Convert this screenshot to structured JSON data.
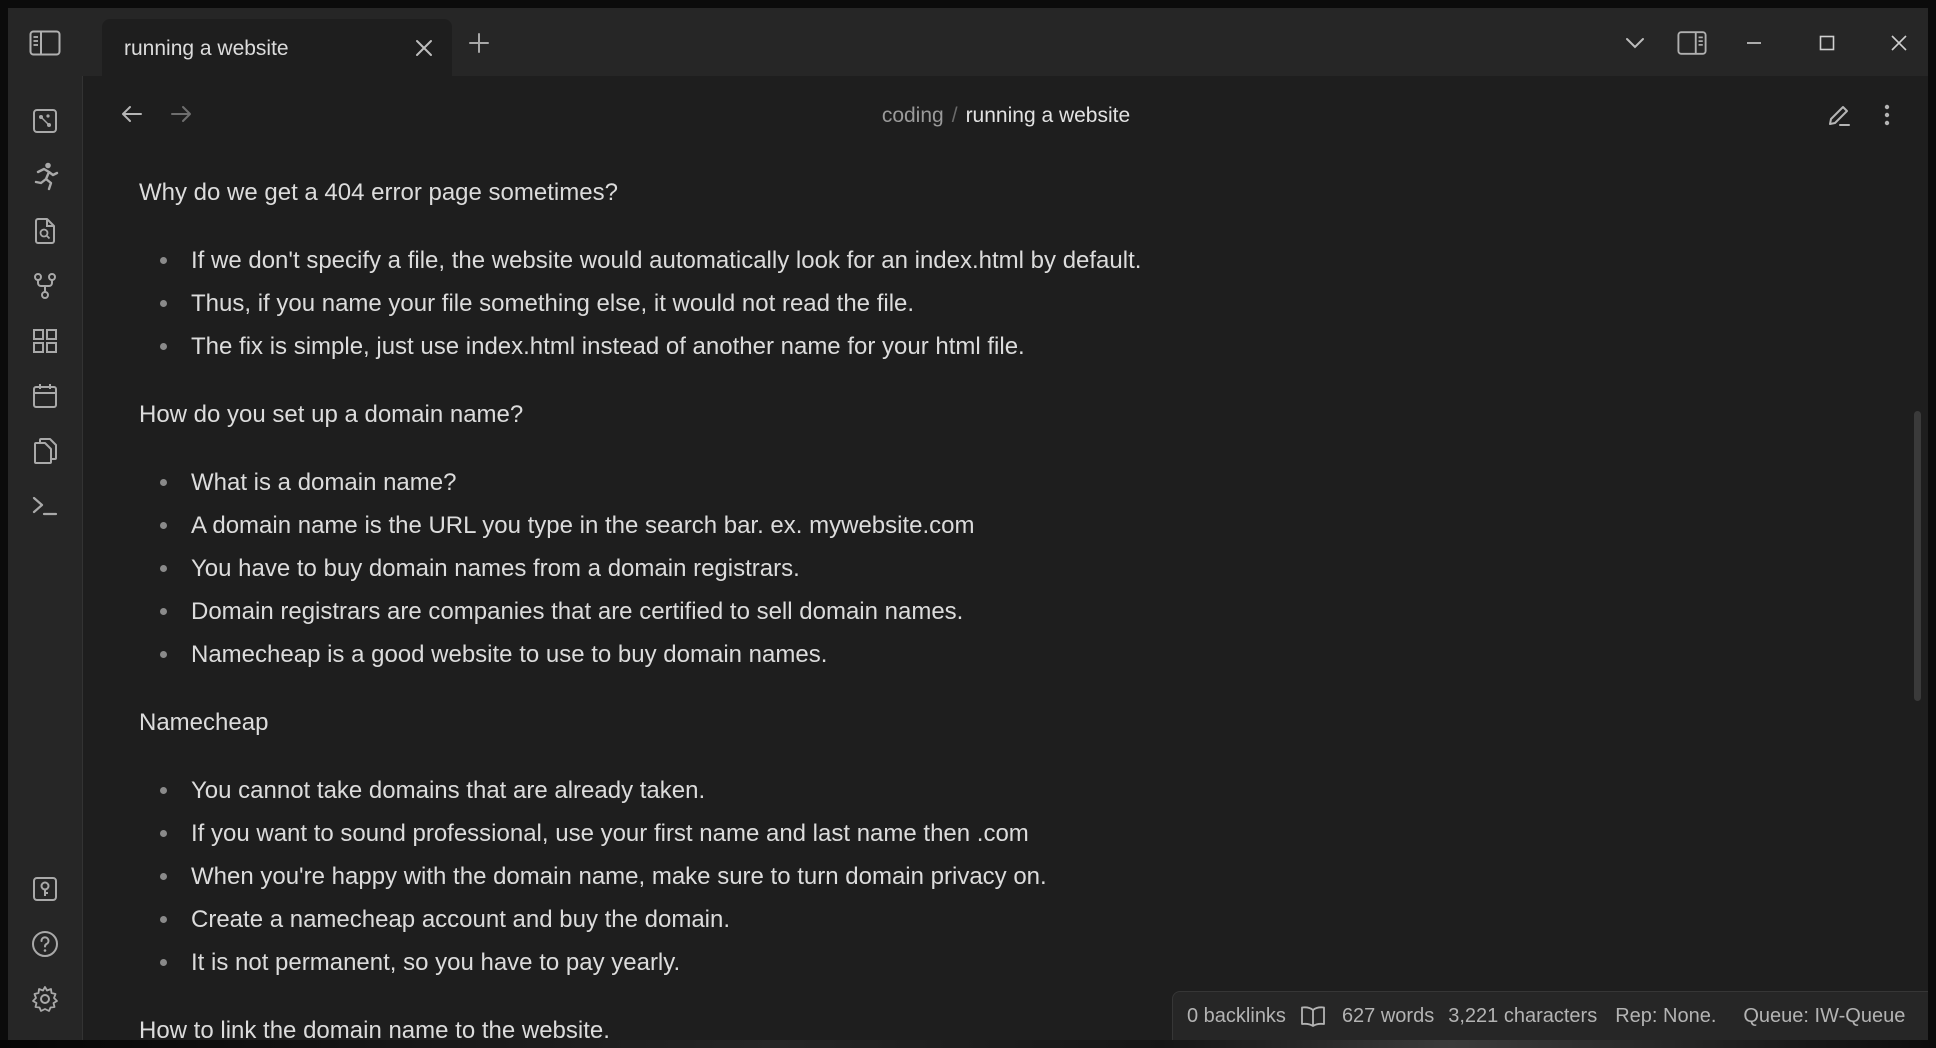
{
  "tab": {
    "title": "running a website"
  },
  "breadcrumb": {
    "parent": "coding",
    "separator": "/",
    "current": "running a website"
  },
  "ribbon": {
    "top_icons": [
      "graph-view-icon",
      "runner-icon",
      "file-search-icon",
      "git-branch-icon",
      "dashboard-icon",
      "calendar-icon",
      "copy-pages-icon",
      "terminal-icon"
    ],
    "bottom_icons": [
      "vault-switcher-icon",
      "help-icon",
      "settings-icon"
    ]
  },
  "document": {
    "sections": [
      {
        "heading": "Why do we get a 404 error page sometimes?",
        "bullets": [
          "If we don't specify a file, the website would automatically look for an index.html by default.",
          "Thus, if you name your file something else, it would not read the file.",
          "The fix is simple, just use index.html instead of another name for your html file."
        ]
      },
      {
        "heading": "How do you set up a domain name?",
        "bullets": [
          "What is a domain name?",
          "A domain name is the URL you type in the search bar. ex. mywebsite.com",
          "You have to buy domain names from a domain registrars.",
          "Domain registrars are companies that are certified to sell domain names.",
          "Namecheap is a good website to use to buy domain names."
        ]
      },
      {
        "heading": "Namecheap",
        "bullets": [
          "You cannot take domains that are already taken.",
          "If you want to sound professional, use your first name and last name then .com",
          "When you're happy with the domain name, make sure to turn domain privacy on.",
          "Create a namecheap account and buy the domain.",
          "It is not permanent, so you have to pay yearly."
        ]
      },
      {
        "heading": "How to link the domain name to the website.",
        "bullets": []
      }
    ]
  },
  "status": {
    "backlinks": "0 backlinks",
    "words": "627 words",
    "characters": "3,221 characters",
    "rep": "Rep: None.",
    "queue": "Queue: IW-Queue"
  }
}
